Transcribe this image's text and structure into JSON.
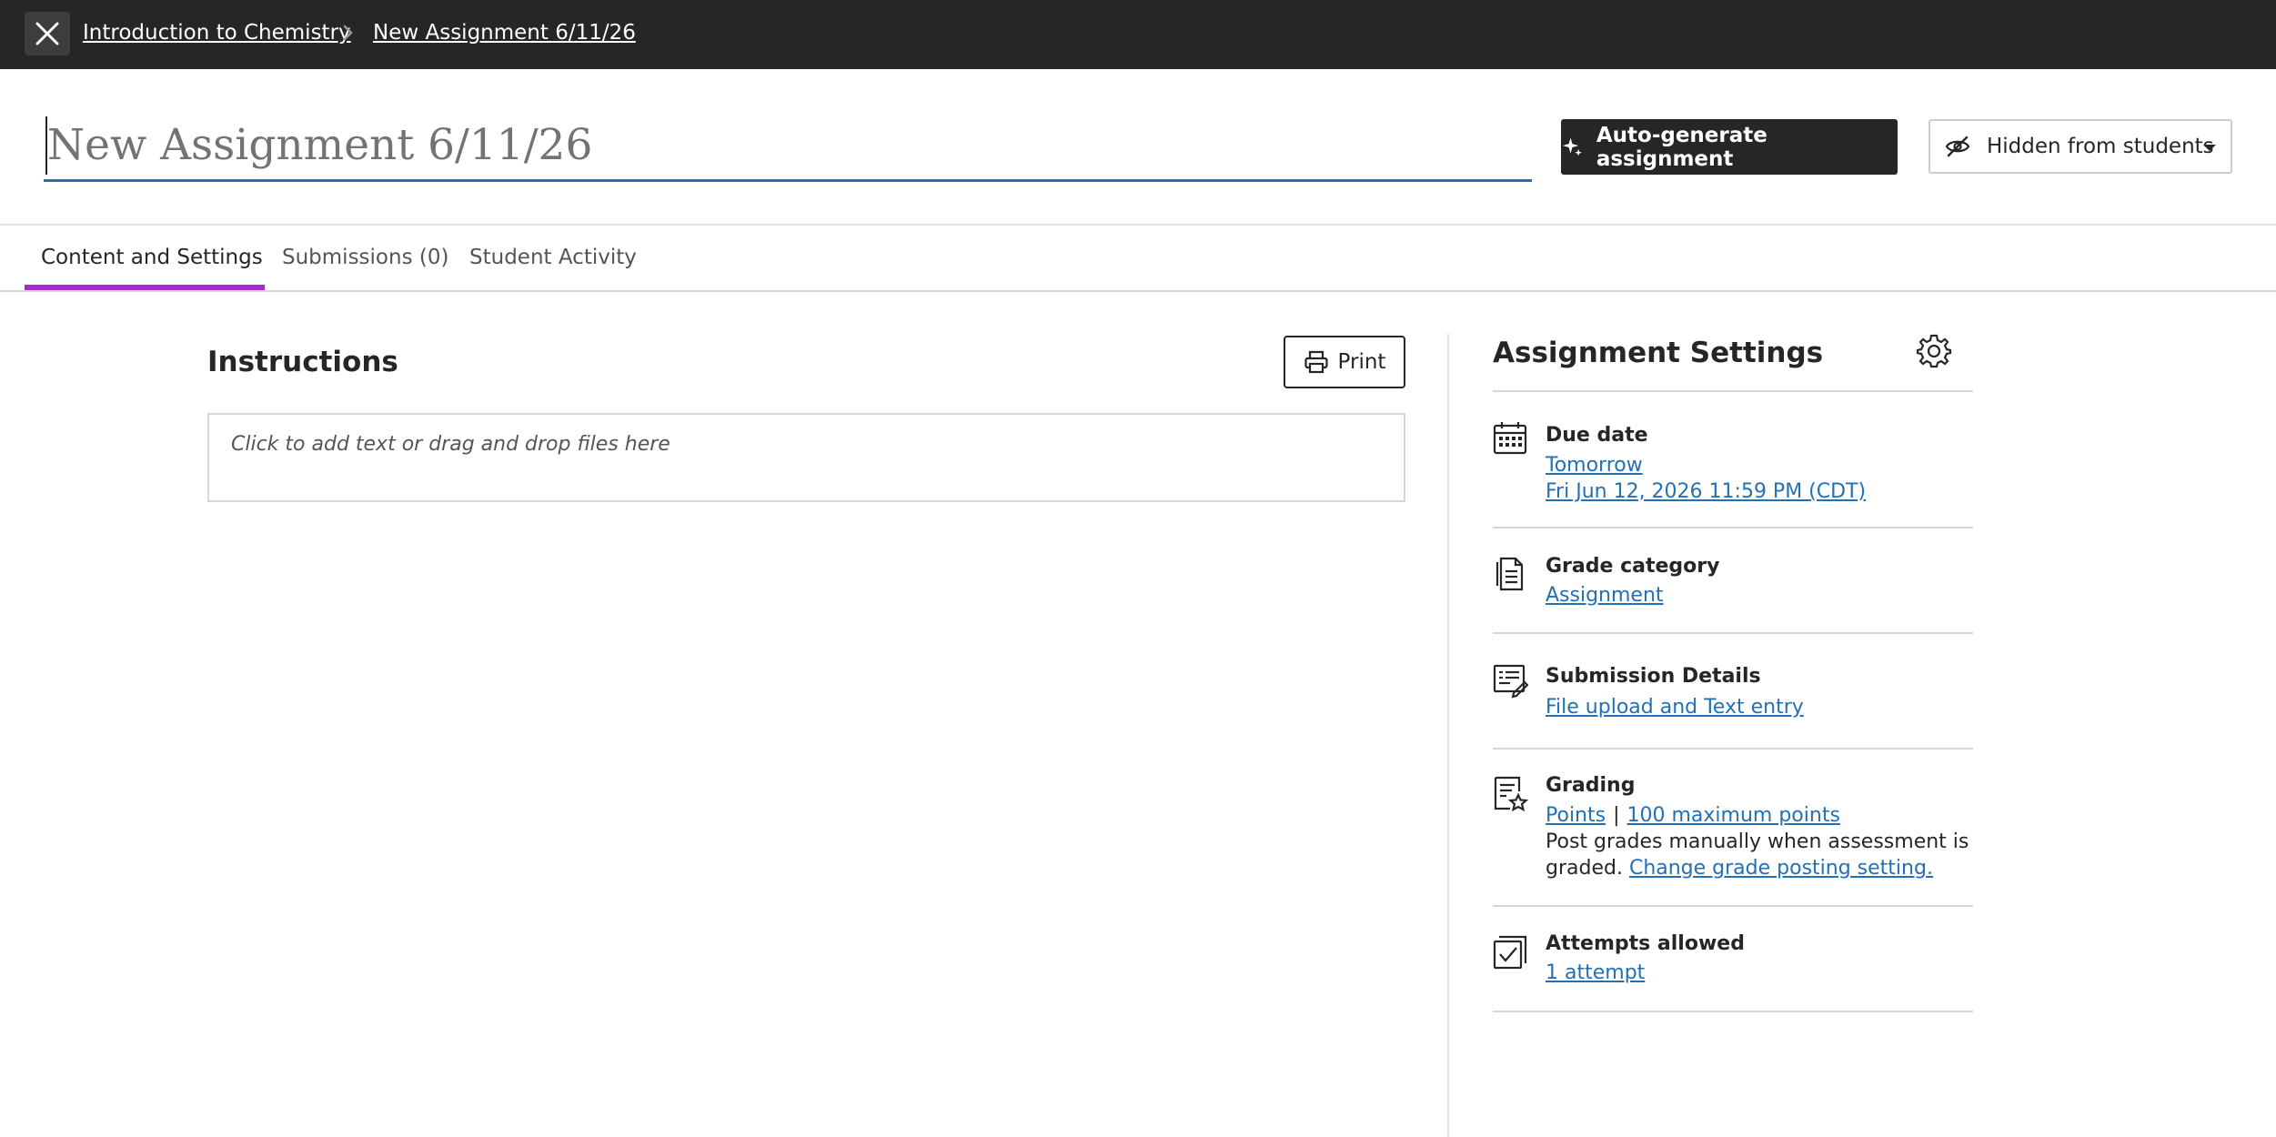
{
  "breadcrumb": {
    "course": "Introduction to Chemistry",
    "assignment": "New Assignment 6/11/26"
  },
  "title": {
    "placeholder": "New Assignment 6/11/26",
    "value": ""
  },
  "header": {
    "autogen_label": "Auto-generate assignment",
    "visibility_label": "Hidden from students"
  },
  "tabs": [
    {
      "label": "Content and Settings",
      "active": true
    },
    {
      "label": "Submissions (0)",
      "active": false
    },
    {
      "label": "Student Activity",
      "active": false
    }
  ],
  "instructions": {
    "heading": "Instructions",
    "print_label": "Print",
    "editor_placeholder": "Click to add text or drag and drop files here"
  },
  "settings": {
    "heading": "Assignment Settings",
    "due_date": {
      "label": "Due date",
      "relative": "Tomorrow",
      "full": "Fri Jun 12, 2026 11:59 PM (CDT)"
    },
    "grade_category": {
      "label": "Grade category",
      "value": "Assignment"
    },
    "submission_details": {
      "label": "Submission Details",
      "value": "File upload and Text entry"
    },
    "grading": {
      "label": "Grading",
      "schema": "Points",
      "separator": "|",
      "max_points": "100 maximum points",
      "posting_line1": "Post grades manually when assessment is",
      "posting_line2": "graded.",
      "posting_link": "Change grade posting setting."
    },
    "attempts": {
      "label": "Attempts allowed",
      "value": "1 attempt"
    }
  },
  "colors": {
    "topbar": "#262626",
    "accent_tab": "#a62bc9",
    "link": "#2370b5",
    "title_underline": "#2e6cb5"
  }
}
